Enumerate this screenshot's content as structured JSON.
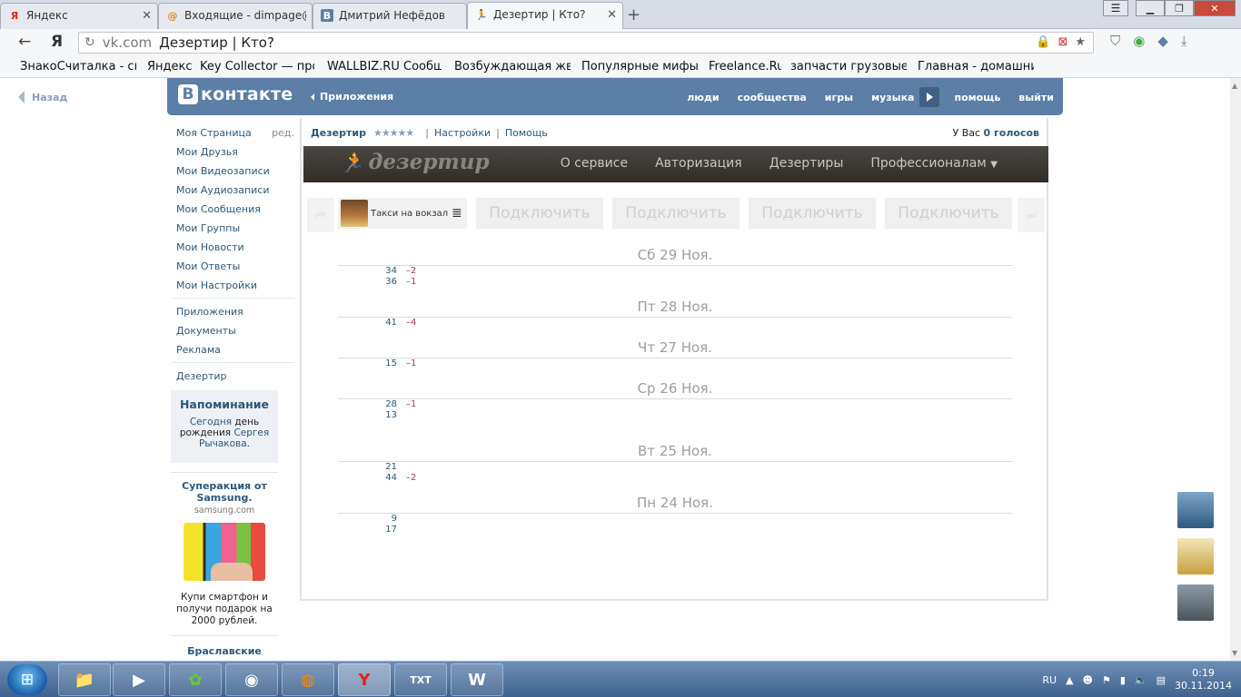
{
  "browser": {
    "tabs": [
      {
        "label": "Яндекс",
        "fav": "Я"
      },
      {
        "label": "Входящие - dimpage@",
        "fav": "@"
      },
      {
        "label": "Дмитрий Нефёдов",
        "fav": "В"
      },
      {
        "label": "Дезертир | Кто?",
        "fav": "🏃"
      }
    ],
    "address_host": "vk.com",
    "address_title": "Дезертир | Кто?",
    "bookmarks": [
      "ЗнакоСчиталка - ск",
      "Яндекс",
      "Key Collector — про",
      "WALLBIZ.RU Сообщ",
      "Возбуждающая жва",
      "Популярные мифы",
      "Freelance.Ru",
      "запчасти грузовые с",
      "Главная - домашни"
    ]
  },
  "page": {
    "back_label": "Назад",
    "header": {
      "logo_letter": "В",
      "logo_text": "контакте",
      "apps_link": "Приложения",
      "nav": [
        "люди",
        "сообщества",
        "игры",
        "музыка",
        "помощь",
        "выйти"
      ]
    },
    "sidebar": {
      "items": [
        {
          "label": "Моя Страница",
          "extra": "ред."
        },
        {
          "label": "Мои Друзья"
        },
        {
          "label": "Мои Видеозаписи"
        },
        {
          "label": "Мои Аудиозаписи"
        },
        {
          "label": "Мои Сообщения"
        },
        {
          "label": "Мои Группы"
        },
        {
          "label": "Мои Новости"
        },
        {
          "label": "Мои Ответы"
        },
        {
          "label": "Мои Настройки"
        }
      ],
      "items2": [
        "Приложения",
        "Документы",
        "Реклама"
      ],
      "items3": [
        "Дезертир"
      ],
      "reminder": {
        "title": "Напоминание",
        "today": "Сегодня",
        "birthday": "день рождения",
        "person": "Сергея Рычакова",
        "dot": "."
      },
      "ad": {
        "title": "Суперакция от Samsung.",
        "url": "samsung.com",
        "text": "Купи смартфон и получи подарок на 2000 рублей."
      },
      "ad2_title": "Браславские озера"
    },
    "app": {
      "name": "Дезертир",
      "rating_stars": "★★★★★",
      "settings": "Настройки",
      "help": "Помощь",
      "votes_prefix": "У Вас",
      "votes_value": "0 голосов",
      "logo_text": "дезертир",
      "menu": [
        "О сервисе",
        "Авторизация",
        "Дезертиры",
        "Профессионалам"
      ],
      "slot_name": "Такси на вокзал",
      "connect_label": "Подключить",
      "days": [
        {
          "label": "Сб 29 Ноя.",
          "rows": [
            {
              "n": "34",
              "d": "–2"
            },
            {
              "n": "36",
              "d": "–1"
            }
          ]
        },
        {
          "label": "Пт 28 Ноя.",
          "rows": [
            {
              "n": "41",
              "d": "–4"
            }
          ]
        },
        {
          "label": "Чт 27 Ноя.",
          "rows": [
            {
              "n": "15",
              "d": "–1"
            }
          ]
        },
        {
          "label": "Ср 26 Ноя.",
          "rows": [
            {
              "n": "28",
              "d": "–1"
            },
            {
              "n": "13",
              "d": ""
            }
          ]
        },
        {
          "label": "Вт 25 Ноя.",
          "rows": [
            {
              "n": "21",
              "d": ""
            },
            {
              "n": "44",
              "d": "–2"
            }
          ]
        },
        {
          "label": "Пн 24 Ноя.",
          "rows": [
            {
              "n": "9",
              "d": ""
            },
            {
              "n": "17",
              "d": ""
            }
          ]
        }
      ]
    }
  },
  "taskbar": {
    "lang": "RU",
    "time": "0:19",
    "date": "30.11.2014"
  },
  "colors": {
    "vk_blue": "#5b7fa6",
    "link": "#2b587a",
    "negative": "#b03a48"
  }
}
